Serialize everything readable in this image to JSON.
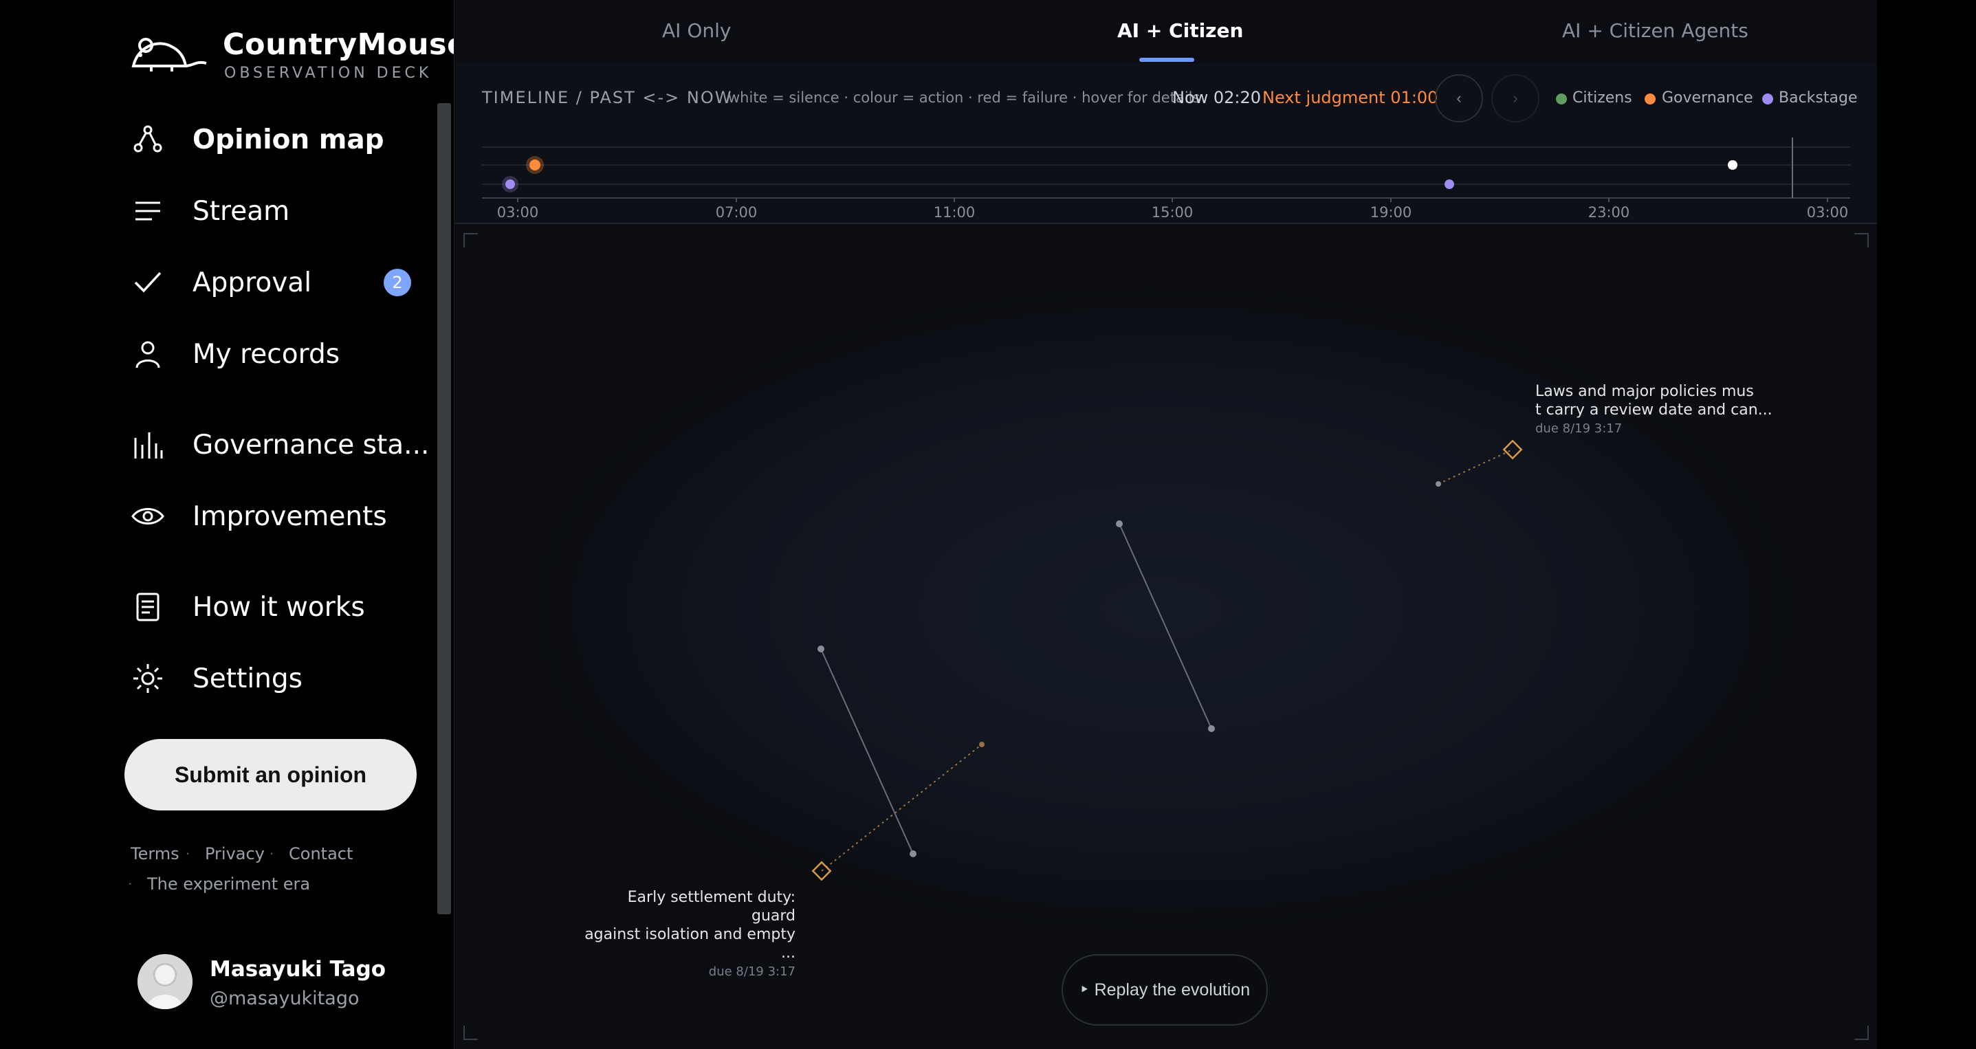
{
  "brand": {
    "name": "CountryMouse",
    "subtitle": "OBSERVATION DECK",
    "logo_icon": "mouse-icon"
  },
  "sidebar": {
    "items": [
      {
        "label": "Opinion map",
        "icon": "network-icon",
        "active": true
      },
      {
        "label": "Stream",
        "icon": "lines-icon"
      },
      {
        "label": "Approval",
        "icon": "check-icon",
        "badge": "2"
      },
      {
        "label": "My records",
        "icon": "person-icon"
      },
      {
        "label": "Governance sta...",
        "icon": "bar-chart-icon"
      },
      {
        "label": "Improvements",
        "icon": "eye-icon"
      },
      {
        "label": "How it works",
        "icon": "document-icon"
      },
      {
        "label": "Settings",
        "icon": "gear-icon"
      }
    ],
    "submit_label": "Submit an opinion",
    "footer_links": [
      "Terms",
      "Privacy",
      "Contact",
      "The experiment era"
    ],
    "user": {
      "name": "Masayuki Tago",
      "handle": "@masayukitago"
    }
  },
  "tabs": [
    {
      "label": "AI Only"
    },
    {
      "label": "AI + Citizen",
      "active": true
    },
    {
      "label": "AI + Citizen Agents"
    }
  ],
  "timeline": {
    "title": "TIMELINE / PAST <-> NOW",
    "legend_text": "white = silence · colour = action · red = failure · hover for details",
    "now": "Now 02:20",
    "next_judgment": "Next judgment 01:00",
    "prev_label": "‹",
    "next_label": "›",
    "legend": [
      {
        "label": "Citizens",
        "color": "#5f9e5f"
      },
      {
        "label": "Governance",
        "color": "#ff8a3d"
      },
      {
        "label": "Backstage",
        "color": "#a08cf0"
      }
    ],
    "ticks": [
      "03:00",
      "07:00",
      "11:00",
      "15:00",
      "19:00",
      "23:00",
      "03:00"
    ]
  },
  "callouts": [
    {
      "text_line1": "Laws and major policies mus",
      "text_line2": "t carry a review date and can...",
      "due": "due 8/19 3:17"
    },
    {
      "text_line1": "Early settlement duty: guard",
      "text_line2": "against isolation and empty ...",
      "due": "due 8/19 3:17"
    }
  ],
  "replay_label": "‣ Replay the evolution",
  "colors": {
    "accent": "#6b9bff",
    "governance": "#ff8a3d",
    "backstage": "#a08cf0",
    "citizens": "#5f9e5f",
    "diamond": "#d89a4a"
  }
}
